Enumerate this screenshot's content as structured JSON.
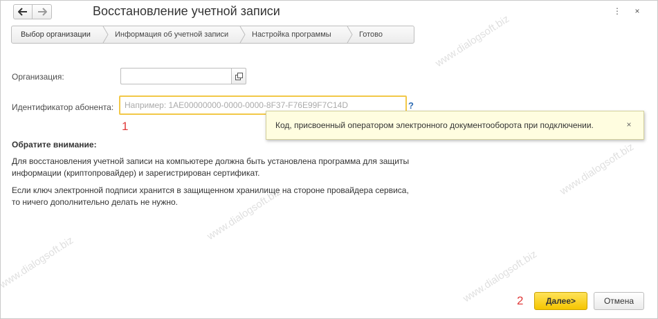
{
  "window": {
    "title": "Восстановление учетной записи",
    "more_glyph": "⋮",
    "close_glyph": "×"
  },
  "steps": [
    {
      "label": "Выбор организации"
    },
    {
      "label": "Информация об учетной записи"
    },
    {
      "label": "Настройка программы"
    },
    {
      "label": "Готово"
    }
  ],
  "form": {
    "org_label": "Организация:",
    "org_value": "",
    "id_label": "Идентификатор абонента:",
    "id_value": "",
    "id_placeholder": "Например: 1AE00000000-0000-0000-8F37-F76E99F7C14D",
    "help_mark": "?"
  },
  "tooltip": {
    "text": "Код, присвоенный оператором электронного документооборота при подключении.",
    "close_glyph": "×"
  },
  "annotations": [
    "1",
    "2"
  ],
  "notice": {
    "heading": "Обратите внимание:",
    "paragraphs": [
      "Для восстановления учетной записи на компьютере должна быть установлена программа для защиты информации (криптопровайдер) и зарегистрирован сертификат.",
      "Если ключ электронной подписи хранится в защищенном хранилище на стороне провайдера сервиса, то ничего дополнительно делать не нужно."
    ]
  },
  "buttons": {
    "next": "Далее>",
    "cancel": "Отмена"
  },
  "watermark": "www.dialogsoft.biz",
  "colors": {
    "accent": "#f5c500",
    "focus_border": "#f2c847",
    "help": "#2d6bb3",
    "annotation": "#e03a3a",
    "tooltip_bg": "#fffde0"
  }
}
